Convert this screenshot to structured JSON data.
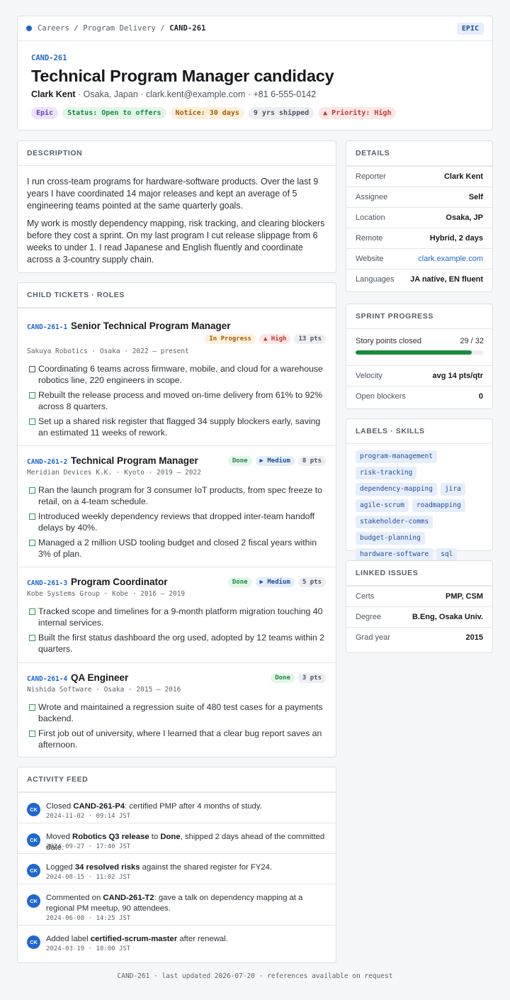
{
  "breadcrumb": {
    "parts": [
      "Careers",
      "Program Delivery"
    ],
    "current": "CAND-261",
    "sep": "/"
  },
  "header": {
    "type_badge": "EPIC",
    "key": "CAND-261",
    "title": "Technical Program Manager candidacy",
    "name": "Clark Kent",
    "contact_rest": " · Osaka, Japan · clark.kent@example.com · +81 6-555-0142",
    "badges": [
      {
        "text": "Epic",
        "bg": "#ece3fb",
        "fg": "#6b3fc4"
      },
      {
        "text": "Status: Open to offers",
        "bg": "#e3f6e9",
        "fg": "#1c8a3f"
      },
      {
        "text": "Notice: 30 days",
        "bg": "#fdf0dd",
        "fg": "#a95b00"
      },
      {
        "text": "9 yrs shipped",
        "bg": "#eceef1",
        "fg": "#4d5560"
      },
      {
        "text": "▲ Priority: High",
        "bg": "#fde7e7",
        "fg": "#c0392b"
      }
    ]
  },
  "description": {
    "heading": "DESCRIPTION",
    "paragraphs": [
      "I run cross-team programs for hardware-software products. Over the last 9 years I have coordinated 14 major releases and kept an average of 5 engineering teams pointed at the same quarterly goals.",
      "My work is mostly dependency mapping, risk tracking, and clearing blockers before they cost a sprint. On my last program I cut release slippage from 6 weeks to under 1. I read Japanese and English fluently and coordinate across a 3-country supply chain."
    ]
  },
  "roles": {
    "heading": "CHILD TICKETS · ROLES",
    "items": [
      {
        "key": "CAND-261-1",
        "title": "Senior Technical Program Manager",
        "badges": [
          "In Progress",
          "▲ High",
          "13 pts"
        ],
        "meta": "Sakuya Robotics · Osaka · 2022 – present",
        "bullets": [
          "Coordinating 6 teams across firmware, mobile, and cloud for a warehouse robotics line, 220 engineers in scope.",
          "Rebuilt the release process and moved on-time delivery from 61% to 92% across 8 quarters.",
          "Set up a shared risk register that flagged 34 supply blockers early, saving an estimated 11 weeks of rework."
        ]
      },
      {
        "key": "CAND-261-2",
        "title": "Technical Program Manager",
        "badges": [
          "Done",
          "▶ Medium",
          "8 pts"
        ],
        "meta": "Meridian Devices K.K. · Kyoto · 2019 – 2022",
        "bullets": [
          "Ran the launch program for 3 consumer IoT products, from spec freeze to retail, on a 4-team schedule.",
          "Introduced weekly dependency reviews that dropped inter-team handoff delays by 40%.",
          "Managed a 2 million USD tooling budget and closed 2 fiscal years within 3% of plan."
        ]
      },
      {
        "key": "CAND-261-3",
        "title": "Program Coordinator",
        "badges": [
          "Done",
          "▶ Medium",
          "5 pts"
        ],
        "meta": "Kobe Systems Group · Kobe · 2016 – 2019",
        "bullets": [
          "Tracked scope and timelines for a 9-month platform migration touching 40 internal services.",
          "Built the first status dashboard the org used, adopted by 12 teams within 2 quarters."
        ]
      },
      {
        "key": "CAND-261-4",
        "title": "QA Engineer",
        "badges": [
          "Done",
          "3 pts"
        ],
        "meta": "Nishida Software · Osaka · 2015 – 2016",
        "bullets": [
          "Wrote and maintained a regression suite of 480 test cases for a payments backend.",
          "First job out of university, where I learned that a clear bug report saves an afternoon."
        ]
      }
    ]
  },
  "activity": {
    "heading": "ACTIVITY FEED",
    "avatar": "CK",
    "items": [
      {
        "pre": "Closed ",
        "b1": "CAND-261-P4",
        "mid": ": certified PMP after 4 months of study.",
        "b2": "",
        "post": "",
        "time": "2024-11-02 · 09:14 JST"
      },
      {
        "pre": "Moved ",
        "b1": "Robotics Q3 release",
        "mid": " to ",
        "b2": "Done",
        "post": ", shipped 2 days ahead of the committed date.",
        "time": "2024-09-27 · 17:40 JST"
      },
      {
        "pre": "Logged ",
        "b1": "34 resolved risks",
        "mid": " against the shared register for FY24.",
        "b2": "",
        "post": "",
        "time": "2024-08-15 · 11:02 JST"
      },
      {
        "pre": "Commented on ",
        "b1": "CAND-261-T2",
        "mid": ": gave a talk on dependency mapping at a regional PM meetup, 90 attendees.",
        "b2": "",
        "post": "",
        "time": "2024-06-08 · 14:25 JST"
      },
      {
        "pre": "Added label ",
        "b1": "certified-scrum-master",
        "mid": " after renewal.",
        "b2": "",
        "post": "",
        "time": "2024-03-19 · 10:00 JST"
      }
    ]
  },
  "details": {
    "heading": "DETAILS",
    "rows": [
      {
        "k": "Reporter",
        "v": "Clark Kent"
      },
      {
        "k": "Assignee",
        "v": "Self"
      },
      {
        "k": "Location",
        "v": "Osaka, JP"
      },
      {
        "k": "Remote",
        "v": "Hybrid, 2 days"
      },
      {
        "k": "Website",
        "v": "clark.example.com"
      },
      {
        "k": "Languages",
        "v": "JA native, EN fluent"
      }
    ]
  },
  "sprint": {
    "heading": "SPRINT PROGRESS",
    "label": "Story points closed",
    "value": "29 / 32",
    "fraction": 0.906,
    "rows": [
      {
        "k": "Velocity",
        "v": "avg 14 pts/qtr"
      },
      {
        "k": "Open blockers",
        "v": "0"
      }
    ]
  },
  "labels": {
    "heading": "LABELS · SKILLS",
    "chips": [
      "program-management",
      "risk-tracking",
      "dependency-mapping",
      "jira",
      "agile-scrum",
      "roadmapping",
      "stakeholder-comms",
      "budget-planning",
      "hardware-software",
      "sql"
    ]
  },
  "linked": {
    "heading": "LINKED ISSUES",
    "rows": [
      {
        "k": "Certs",
        "v": "PMP, CSM"
      },
      {
        "k": "Degree",
        "v": "B.Eng, Osaka Univ."
      },
      {
        "k": "Grad year",
        "v": "2015"
      }
    ]
  },
  "footer": "CAND-261 · last updated 2026-07-20 · references available on request"
}
